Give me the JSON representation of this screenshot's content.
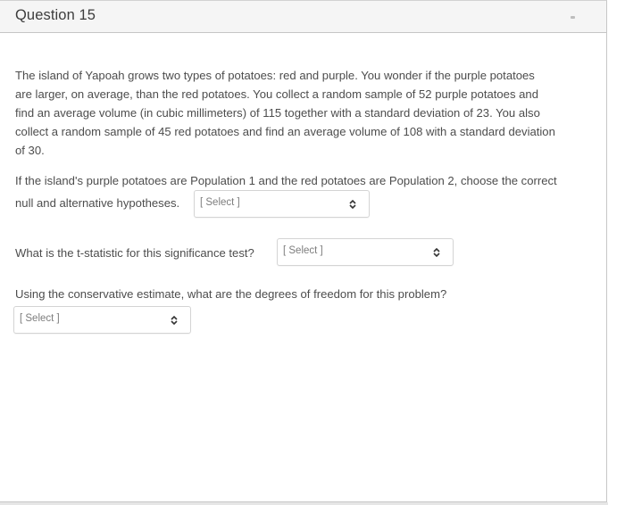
{
  "question": {
    "title": "Question 15",
    "intro": "The island of Yapoah grows two types of potatoes: red and purple.  You wonder if the purple potatoes are larger, on average, than the red potatoes.  You collect a random sample of 52 purple potatoes and find an average volume (in cubic millimeters) of 115 together with a standard deviation of 23.  You also collect a random sample of 45 red potatoes and find an average volume of 108 with a standard deviation of 30.",
    "intro_lines": [
      "The island of Yapoah grows two types of potatoes: red and purple.  You wonder if the purple potatoes",
      "are larger, on average, than the red potatoes.  You collect a random sample of 52 purple potatoes and",
      "find an average volume (in cubic millimeters) of 115 together with a standard deviation of 23.  You also",
      "collect a random sample of 45 red potatoes and find an average volume of 108 with a standard deviation",
      "of 30."
    ],
    "part1": {
      "line1": "If the island's purple potatoes are Population 1 and the red potatoes are Population 2, choose the correct",
      "line2": "null and alternative hypotheses.",
      "select_value": "[ Select ]"
    },
    "part2": {
      "prompt": "What is the t-statistic for this significance test?",
      "select_value": "[ Select ]"
    },
    "part3": {
      "prompt": "Using the conservative estimate, what are the degrees of freedom for this problem?",
      "select_value": "[ Select ]"
    }
  },
  "icons": {
    "select_arrow": "up-down-chevron-icon"
  }
}
